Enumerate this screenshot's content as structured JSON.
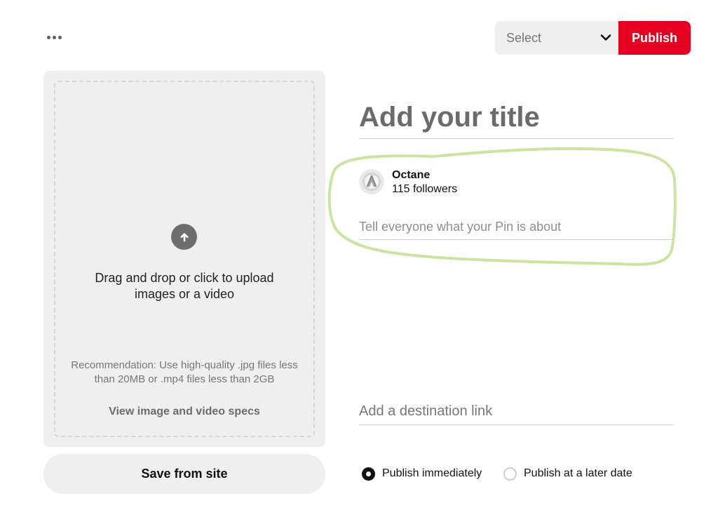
{
  "header": {
    "more_options_icon": "ellipsis-horizontal-icon",
    "board_select": {
      "label": "Select",
      "icon": "chevron-down-icon"
    },
    "publish_label": "Publish",
    "publish_color": "#e60023"
  },
  "upload": {
    "icon": "arrow-up-circle-icon",
    "instruction": "Drag and drop or click to upload images or a video",
    "recommendation": "Recommendation: Use high-quality .jpg files less than 20MB or .mp4 files less than 2GB",
    "specs_link": "View image and video specs"
  },
  "save_from_site_label": "Save from site",
  "form": {
    "title_placeholder": "Add your title",
    "user": {
      "name": "Octane",
      "followers": "115 followers",
      "avatar_icon": "octane-logo-icon"
    },
    "description_placeholder": "Tell everyone what your Pin is about",
    "destination_placeholder": "Add a destination link",
    "highlight_color": "#c9e5a0"
  },
  "publish_options": {
    "selected": "Publish immediately",
    "options": [
      {
        "label": "Publish immediately",
        "checked": true
      },
      {
        "label": "Publish at a later date",
        "checked": false
      }
    ]
  }
}
